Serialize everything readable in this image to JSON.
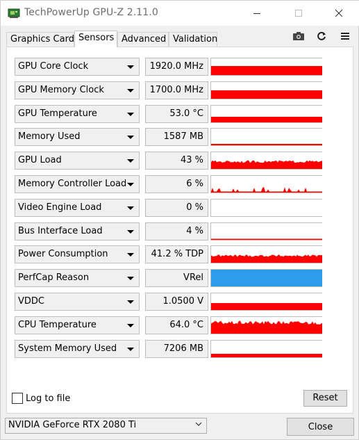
{
  "window": {
    "title": "TechPowerUp GPU-Z 2.11.0"
  },
  "tabs": [
    {
      "label": "Graphics Card"
    },
    {
      "label": "Sensors"
    },
    {
      "label": "Advanced"
    },
    {
      "label": "Validation"
    }
  ],
  "toolbar_icons": [
    "camera-icon",
    "refresh-icon",
    "menu-icon"
  ],
  "sensors": [
    {
      "label": "GPU Core Clock",
      "value": "1920.0 MHz",
      "graph": {
        "kind": "fill",
        "level": 0.55
      }
    },
    {
      "label": "GPU Memory Clock",
      "value": "1700.0 MHz",
      "graph": {
        "kind": "fill",
        "level": 0.5
      }
    },
    {
      "label": "GPU Temperature",
      "value": "53.0 °C",
      "graph": {
        "kind": "fill",
        "level": 0.35
      }
    },
    {
      "label": "Memory Used",
      "value": "1587 MB",
      "graph": {
        "kind": "fill",
        "level": 0.1
      }
    },
    {
      "label": "GPU Load",
      "value": "43 %",
      "graph": {
        "kind": "noisy",
        "level": 0.43
      }
    },
    {
      "label": "Memory Controller Load",
      "value": "6 %",
      "graph": {
        "kind": "spiky",
        "level": 0.06
      }
    },
    {
      "label": "Video Engine Load",
      "value": "0 %",
      "graph": {
        "kind": "empty",
        "level": 0
      }
    },
    {
      "label": "Bus Interface Load",
      "value": "4 %",
      "graph": {
        "kind": "line",
        "level": 0.04
      }
    },
    {
      "label": "Power Consumption",
      "value": "41.2 % TDP",
      "graph": {
        "kind": "noisy",
        "level": 0.41
      }
    },
    {
      "label": "PerfCap Reason",
      "value": "VRel",
      "graph": {
        "kind": "status",
        "level": 1,
        "color": "#2d9ceb"
      }
    },
    {
      "label": "VDDC",
      "value": "1.0500 V",
      "graph": {
        "kind": "fill",
        "level": 0.42
      }
    },
    {
      "label": "CPU Temperature",
      "value": "64.0 °C",
      "graph": {
        "kind": "noisy",
        "level": 0.64
      }
    },
    {
      "label": "System Memory Used",
      "value": "7206 MB",
      "graph": {
        "kind": "fill",
        "level": 0.22
      }
    }
  ],
  "footer": {
    "log_label": "Log to file",
    "log_checked": false,
    "reset_label": "Reset",
    "gpu_selected": "NVIDIA GeForce RTX 2080 Ti",
    "close_label": "Close"
  },
  "colors": {
    "graph": "#ff0000",
    "perfcap": "#2d9ceb"
  }
}
